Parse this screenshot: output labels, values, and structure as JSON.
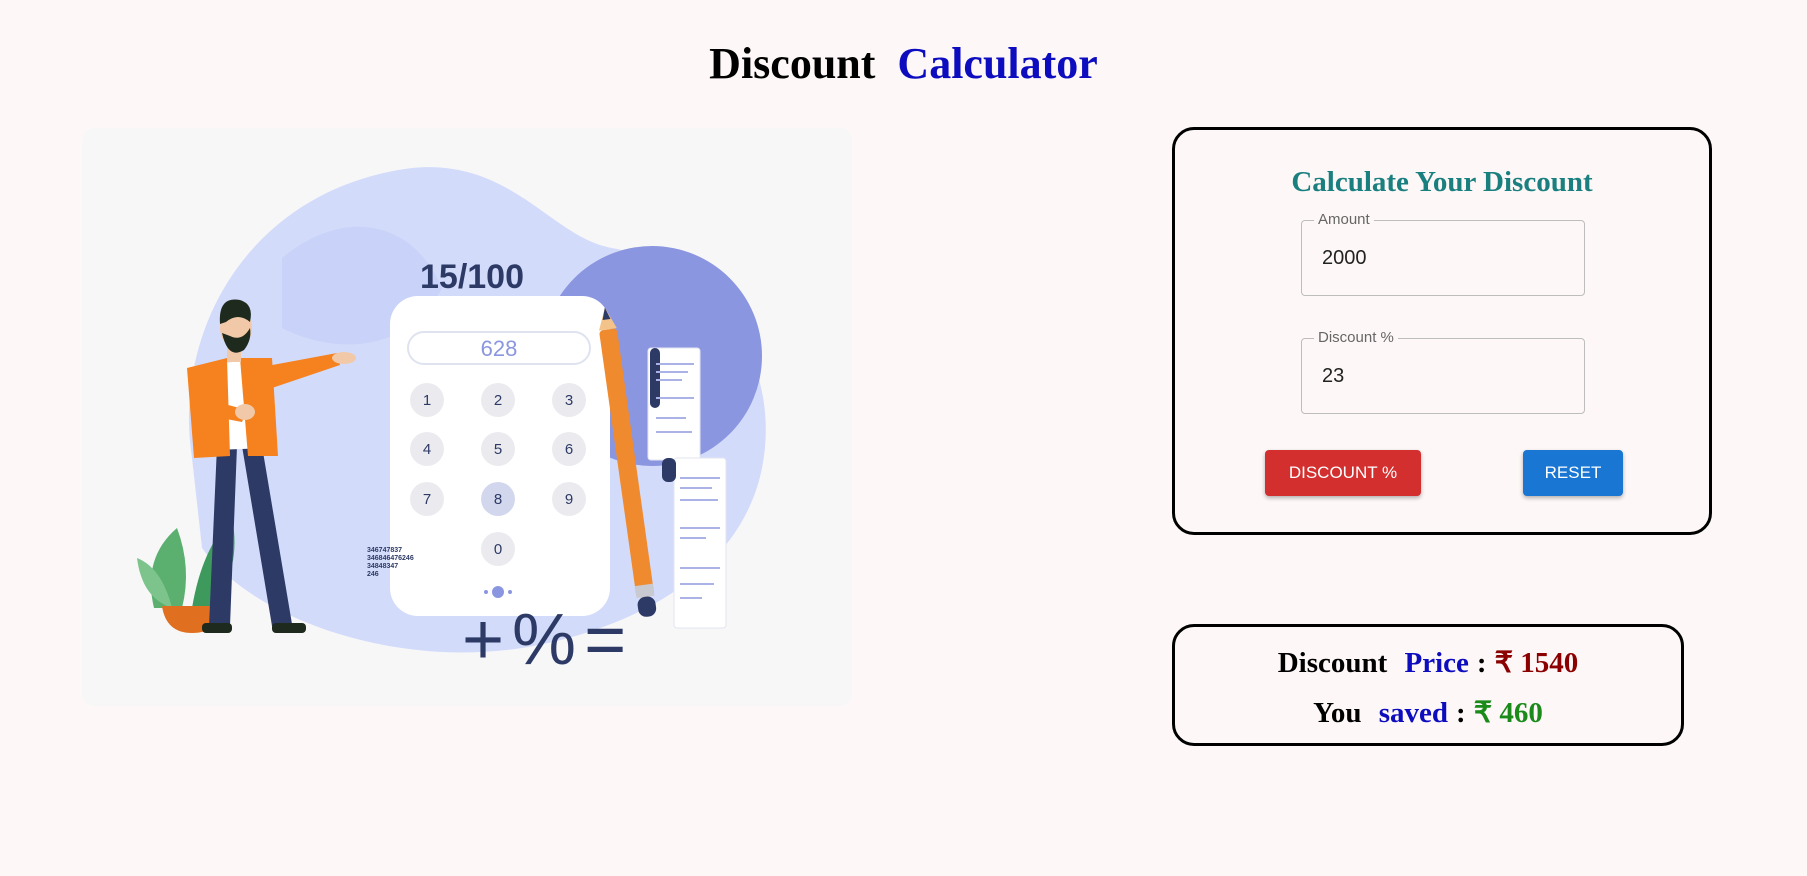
{
  "header": {
    "title_part1": "Discount",
    "title_part2": "Calculator"
  },
  "illustration": {
    "fraction": "15/100",
    "display": "628",
    "keys": [
      "1",
      "2",
      "3",
      "4",
      "5",
      "6",
      "7",
      "8",
      "9",
      "0"
    ],
    "symbols": "+%=",
    "receipt_numbers": [
      "346747837",
      "346846476246",
      "34848347",
      "246"
    ]
  },
  "form": {
    "title": "Calculate Your Discount",
    "amount_label": "Amount",
    "amount_value": "2000",
    "discount_label": "Discount %",
    "discount_value": "23",
    "discount_button": "DISCOUNT %",
    "reset_button": "RESET"
  },
  "result": {
    "discount_word": "Discount",
    "price_word": "Price",
    "separator": ":",
    "price_value": "₹ 1540",
    "you_word": "You",
    "saved_word": "saved",
    "saved_value": "₹ 460"
  },
  "colors": {
    "background": "#fdf8f7",
    "title_blue": "#0d0dbf",
    "card_title": "#1a7f7f",
    "discount_button": "#d32f2f",
    "reset_button": "#1976d2",
    "price_value": "#8b0000",
    "saved_value": "#1a8a1a"
  }
}
